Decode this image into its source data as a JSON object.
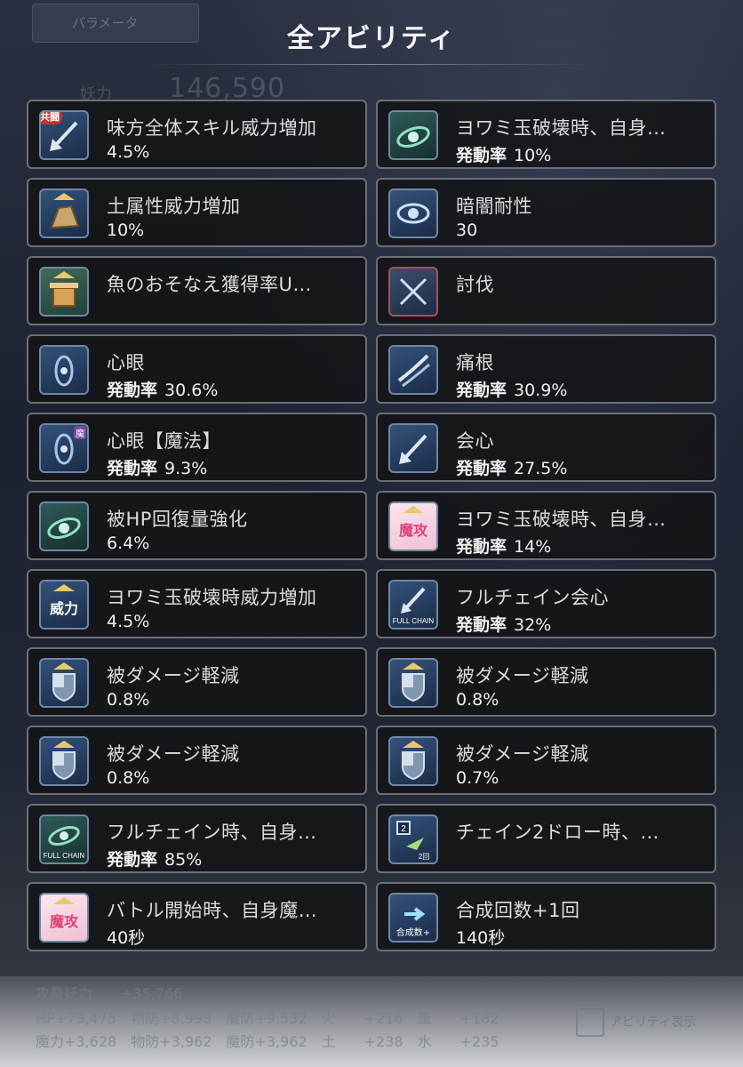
{
  "background": {
    "tab_label": "パラメータ",
    "stat_label": "妖力",
    "stat_value": "146,590",
    "bottom_rows": [
      "攻撃妖力　　+35,766",
      "HP+73,475　物防+8,998　魔防+9,532　火　　+216　風　　+182",
      "魔力+3,628　物防+3,962　魔防+3,962　土　　+238　水　　+235"
    ],
    "checkbox_label": "アビリティ表示"
  },
  "title": "全アビリティ",
  "abilities": [
    {
      "name": "味方全体スキル威力増加",
      "prefix": "",
      "value": "4.5%",
      "icon": "arrow-icon",
      "badge": "共闘"
    },
    {
      "name": "ヨワミ玉破壊時、自身…",
      "prefix": "発動率",
      "value": "10%",
      "icon": "orb-swirl-icon",
      "badge": ""
    },
    {
      "name": "土属性威力増加",
      "prefix": "",
      "value": "10%",
      "icon": "earth-rock-icon",
      "badge": ""
    },
    {
      "name": "暗闇耐性",
      "prefix": "",
      "value": "30",
      "icon": "eye-icon",
      "badge": ""
    },
    {
      "name": "魚のおそなえ獲得率U…",
      "prefix": "",
      "value": "",
      "icon": "offering-box-icon",
      "badge": ""
    },
    {
      "name": "討伐",
      "prefix": "",
      "value": "",
      "icon": "crossed-swords-icon",
      "badge": ""
    },
    {
      "name": "心眼",
      "prefix": "発動率",
      "value": "30.6%",
      "icon": "mind-eye-icon",
      "badge": ""
    },
    {
      "name": "痛根",
      "prefix": "発動率",
      "value": "30.9%",
      "icon": "slash-icon",
      "badge": ""
    },
    {
      "name": "心眼【魔法】",
      "prefix": "発動率",
      "value": "9.3%",
      "icon": "mind-eye-magic-icon",
      "badge": "魔"
    },
    {
      "name": "会心",
      "prefix": "発動率",
      "value": "27.5%",
      "icon": "critical-arrow-icon",
      "badge": ""
    },
    {
      "name": "被HP回復量強化",
      "prefix": "",
      "value": "6.4%",
      "icon": "heal-swirl-icon",
      "badge": ""
    },
    {
      "name": "ヨワミ玉破壊時、自身…",
      "prefix": "発動率",
      "value": "14%",
      "icon": "magic-attack-icon",
      "badge": "魔攻"
    },
    {
      "name": "ヨワミ玉破壊時威力増加",
      "prefix": "",
      "value": "4.5%",
      "icon": "power-icon",
      "badge": "威力"
    },
    {
      "name": "フルチェイン会心",
      "prefix": "発動率",
      "value": "32%",
      "icon": "full-chain-critical-icon",
      "badge": "FULL CHAIN"
    },
    {
      "name": "被ダメージ軽減",
      "prefix": "",
      "value": "0.8%",
      "icon": "shield-icon",
      "badge": ""
    },
    {
      "name": "被ダメージ軽減",
      "prefix": "",
      "value": "0.8%",
      "icon": "shield-icon",
      "badge": ""
    },
    {
      "name": "被ダメージ軽減",
      "prefix": "",
      "value": "0.8%",
      "icon": "shield-icon",
      "badge": ""
    },
    {
      "name": "被ダメージ軽減",
      "prefix": "",
      "value": "0.7%",
      "icon": "shield-icon",
      "badge": ""
    },
    {
      "name": "フルチェイン時、自身…",
      "prefix": "発動率",
      "value": "85%",
      "icon": "full-chain-swirl-icon",
      "badge": "FULL CHAIN"
    },
    {
      "name": "チェイン2ドロー時、…",
      "prefix": "",
      "value": "",
      "icon": "chain-draw-icon",
      "badge": "2"
    },
    {
      "name": "バトル開始時、自身魔…",
      "prefix": "",
      "value": "40秒",
      "icon": "magic-attack-icon",
      "badge": "魔攻"
    },
    {
      "name": "合成回数+1回",
      "prefix": "",
      "value": "140秒",
      "icon": "synthesis-count-icon",
      "badge": "合成数+"
    }
  ],
  "colors": {
    "card_border": "#6b6f77",
    "icon_blue": "#33527a",
    "icon_red_border": "#a55060",
    "accent_gold": "#e8c86a",
    "magic_pink": "#f2a8c8"
  }
}
